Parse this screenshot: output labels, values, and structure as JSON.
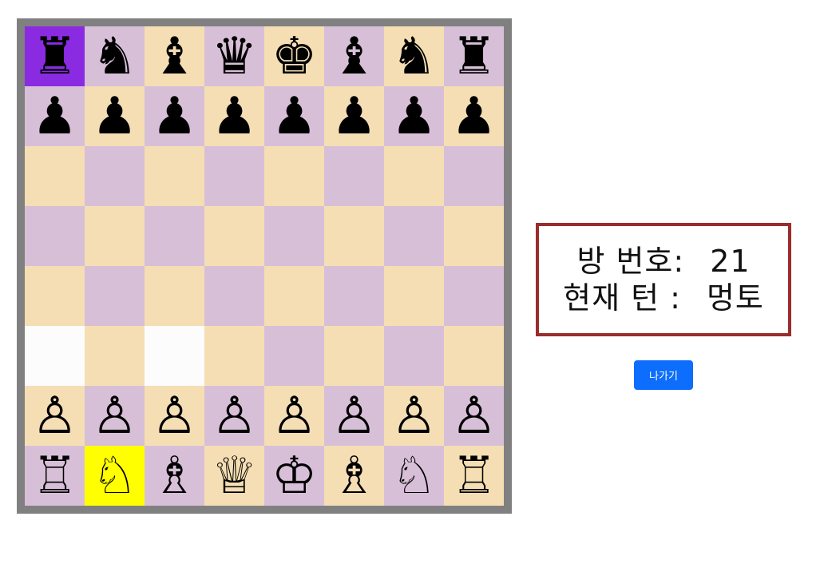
{
  "board": {
    "rows": [
      [
        {
          "piece": "♜",
          "color": "black",
          "name": "black-rook-icon",
          "bg": "#8a2be2"
        },
        {
          "piece": "♞",
          "color": "black",
          "name": "black-knight-icon"
        },
        {
          "piece": "♝",
          "color": "black",
          "name": "black-bishop-icon"
        },
        {
          "piece": "♛",
          "color": "black",
          "name": "black-queen-icon"
        },
        {
          "piece": "♚",
          "color": "black",
          "name": "black-king-icon"
        },
        {
          "piece": "♝",
          "color": "black",
          "name": "black-bishop-icon"
        },
        {
          "piece": "♞",
          "color": "black",
          "name": "black-knight-icon"
        },
        {
          "piece": "♜",
          "color": "black",
          "name": "black-rook-icon"
        }
      ],
      [
        {
          "piece": "♟",
          "color": "black",
          "name": "black-pawn-icon"
        },
        {
          "piece": "♟",
          "color": "black",
          "name": "black-pawn-icon"
        },
        {
          "piece": "♟",
          "color": "black",
          "name": "black-pawn-icon"
        },
        {
          "piece": "♟",
          "color": "black",
          "name": "black-pawn-icon"
        },
        {
          "piece": "♟",
          "color": "black",
          "name": "black-pawn-icon"
        },
        {
          "piece": "♟",
          "color": "black",
          "name": "black-pawn-icon"
        },
        {
          "piece": "♟",
          "color": "black",
          "name": "black-pawn-icon"
        },
        {
          "piece": "♟",
          "color": "black",
          "name": "black-pawn-icon"
        }
      ],
      [
        {},
        {},
        {},
        {},
        {},
        {},
        {},
        {}
      ],
      [
        {},
        {},
        {},
        {},
        {},
        {},
        {},
        {}
      ],
      [
        {},
        {},
        {},
        {},
        {},
        {},
        {},
        {}
      ],
      [
        {
          "bg": "#fcfcfc"
        },
        {},
        {
          "bg": "#fcfcfc"
        },
        {},
        {},
        {},
        {},
        {}
      ],
      [
        {
          "piece": "♙",
          "color": "white",
          "name": "white-pawn-icon"
        },
        {
          "piece": "♙",
          "color": "white",
          "name": "white-pawn-icon"
        },
        {
          "piece": "♙",
          "color": "white",
          "name": "white-pawn-icon"
        },
        {
          "piece": "♙",
          "color": "white",
          "name": "white-pawn-icon"
        },
        {
          "piece": "♙",
          "color": "white",
          "name": "white-pawn-icon"
        },
        {
          "piece": "♙",
          "color": "white",
          "name": "white-pawn-icon"
        },
        {
          "piece": "♙",
          "color": "white",
          "name": "white-pawn-icon"
        },
        {
          "piece": "♙",
          "color": "white",
          "name": "white-pawn-icon"
        }
      ],
      [
        {
          "piece": "♖",
          "color": "white",
          "name": "white-rook-icon"
        },
        {
          "piece": "♘",
          "color": "white",
          "name": "white-knight-icon",
          "bg": "#ffff00"
        },
        {
          "piece": "♗",
          "color": "white",
          "name": "white-bishop-icon"
        },
        {
          "piece": "♕",
          "color": "white",
          "name": "white-queen-icon"
        },
        {
          "piece": "♔",
          "color": "white",
          "name": "white-king-icon"
        },
        {
          "piece": "♗",
          "color": "white",
          "name": "white-bishop-icon"
        },
        {
          "piece": "♘",
          "color": "white",
          "name": "white-knight-icon"
        },
        {
          "piece": "♖",
          "color": "white",
          "name": "white-rook-icon"
        }
      ]
    ],
    "light_color": "#f5deb3",
    "dark_color": "#d8bfd8"
  },
  "info": {
    "room_label": "방 번호:",
    "room_number": "21",
    "turn_label": "현재 턴 :",
    "turn_value": "멍토"
  },
  "exit_button": {
    "label": "나가기"
  }
}
